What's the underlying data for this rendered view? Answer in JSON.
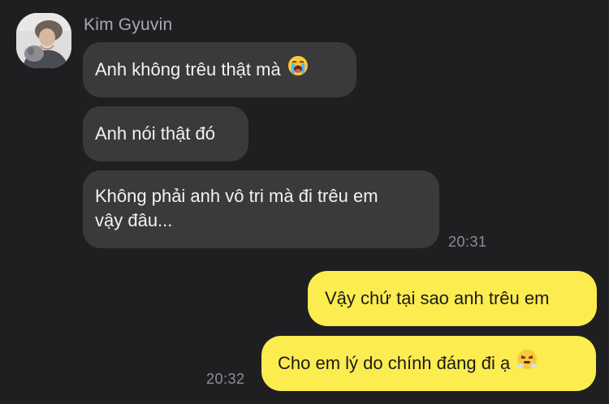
{
  "conversation": {
    "sender_name": "Kim Gyuvin",
    "incoming": [
      {
        "text": "Anh không trêu thật mà",
        "emoji": "loudly-crying-face"
      },
      {
        "text": "Anh nói thật đó"
      },
      {
        "text_line1": "Không phải anh vô tri mà đi trêu em",
        "text_line2": "vậy đâu..."
      }
    ],
    "incoming_time": "20:31",
    "outgoing": [
      {
        "text": "Vậy chứ tại sao anh trêu em"
      },
      {
        "text": "Cho em lý do chính đáng đi ạ",
        "emoji": "face-with-steam-from-nose"
      }
    ],
    "outgoing_time": "20:32"
  },
  "colors": {
    "background": "#1f1f21",
    "incoming_bubble": "#3a3a3c",
    "outgoing_bubble": "#fcec4f",
    "muted_text": "#8e8e93"
  }
}
